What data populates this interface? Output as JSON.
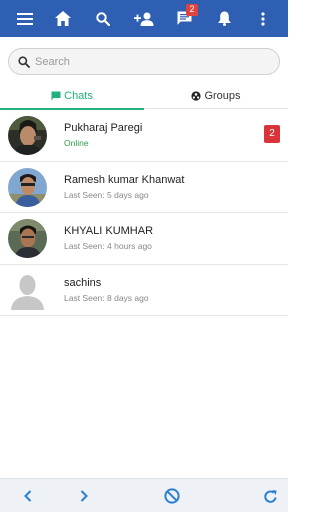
{
  "toolbar": {
    "icons": [
      "menu-icon",
      "home-icon",
      "search-icon",
      "add-contact-icon",
      "message-icon",
      "bell-icon",
      "more-vertical-icon"
    ],
    "message_badge": "2",
    "bar_color": "#2f5fb2"
  },
  "search": {
    "placeholder": "Search",
    "value": ""
  },
  "tabs": [
    {
      "label": "Chats",
      "icon": "chat-icon",
      "active": true
    },
    {
      "label": "Groups",
      "icon": "groups-icon",
      "active": false
    }
  ],
  "chats": [
    {
      "name": "Pukharaj Paregi",
      "status": "Online",
      "online": true,
      "unread": "2"
    },
    {
      "name": "Ramesh kumar Khanwat",
      "status": "Last Seen: 5 days ago",
      "online": false,
      "unread": ""
    },
    {
      "name": "KHYALI KUMHAR",
      "status": "Last Seen: 4 hours ago",
      "online": false,
      "unread": ""
    },
    {
      "name": "sachins",
      "status": "Last Seen: 8 days ago",
      "online": false,
      "unread": ""
    }
  ],
  "bottombar": {
    "icons": [
      "back-icon",
      "forward-icon",
      "block-icon",
      "refresh-icon"
    ],
    "accent": "#2f7fd0"
  },
  "colors": {
    "active_tab": "#20b27a",
    "unread_badge": "#d9343a",
    "online": "#2e9e4a"
  }
}
